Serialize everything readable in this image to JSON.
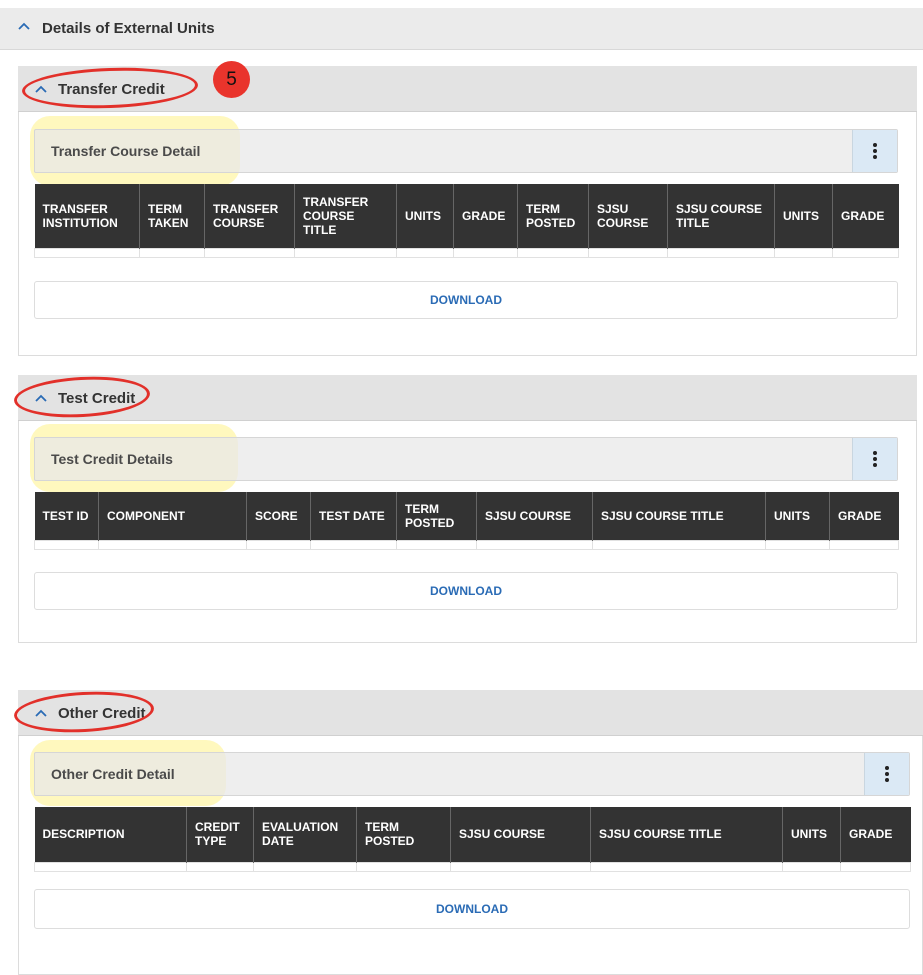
{
  "header": {
    "title": "Details of External Units"
  },
  "transfer": {
    "title": "Transfer Credit",
    "subheader": "Transfer Course Detail",
    "columns": [
      "TRANSFER INSTITUTION",
      "TERM TAKEN",
      "TRANSFER COURSE",
      "TRANSFER COURSE TITLE",
      "UNITS",
      "GRADE",
      "TERM POSTED",
      "SJSU COURSE",
      "SJSU COURSE TITLE",
      "UNITS",
      "GRADE"
    ],
    "download_label": "DOWNLOAD"
  },
  "test": {
    "title": "Test Credit",
    "subheader": "Test Credit Details",
    "columns": [
      "TEST ID",
      "COMPONENT",
      "SCORE",
      "TEST DATE",
      "TERM POSTED",
      "SJSU COURSE",
      "SJSU COURSE TITLE",
      "UNITS",
      "GRADE"
    ],
    "download_label": "DOWNLOAD"
  },
  "other": {
    "title": "Other Credit",
    "subheader": "Other Credit Detail",
    "columns": [
      "DESCRIPTION",
      "CREDIT TYPE",
      "EVALUATION DATE",
      "TERM POSTED",
      "SJSU COURSE",
      "SJSU COURSE TITLE",
      "UNITS",
      "GRADE"
    ],
    "download_label": "DOWNLOAD"
  },
  "annotation": {
    "step_number": "5"
  },
  "icons": {
    "collapse": "chevron-up-icon",
    "menu": "kebab-menu-icon"
  },
  "colors": {
    "header_bg": "#333333",
    "link_blue": "#2a6bb5",
    "annotation_red": "#e2302a",
    "highlight_yellow": "#fff06e"
  }
}
